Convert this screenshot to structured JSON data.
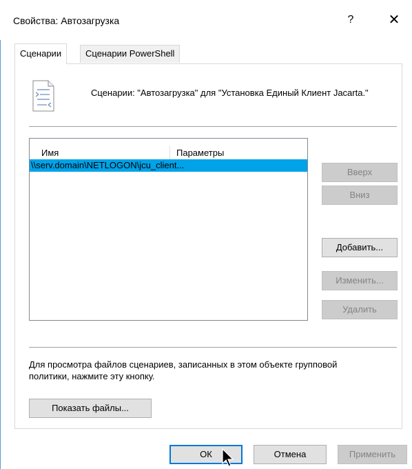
{
  "window": {
    "title": "Свойства: Автозагрузка",
    "help_label": "?",
    "close_label": "✕"
  },
  "tabs": [
    {
      "label": "Сценарии",
      "active": true
    },
    {
      "label": "Сценарии PowerShell",
      "active": false
    }
  ],
  "description": "Сценарии: \"Автозагрузка\" для \"Установка Единый Клиент Jacarta.\"",
  "icons": {
    "script_icon": "script-document-icon",
    "cursor": "mouse-pointer-icon"
  },
  "list": {
    "columns": [
      "Имя",
      "Параметры"
    ],
    "rows": [
      {
        "name": "\\\\serv.domain\\NETLOGON\\jcu_client...",
        "params": "",
        "selected": true
      }
    ]
  },
  "side_buttons": {
    "up": "Вверх",
    "down": "Вниз",
    "add": "Добавить...",
    "edit": "Изменить...",
    "remove": "Удалить"
  },
  "info_text": "Для просмотра файлов сценариев, записанных в этом объекте групповой политики, нажмите эту кнопку.",
  "show_files_label": "Показать файлы...",
  "footer": {
    "ok": "ОК",
    "cancel": "Отмена",
    "apply": "Применить"
  },
  "colors": {
    "selection": "#00a2e8",
    "default_button_border": "#0078d7",
    "disabled_text": "#838383"
  }
}
